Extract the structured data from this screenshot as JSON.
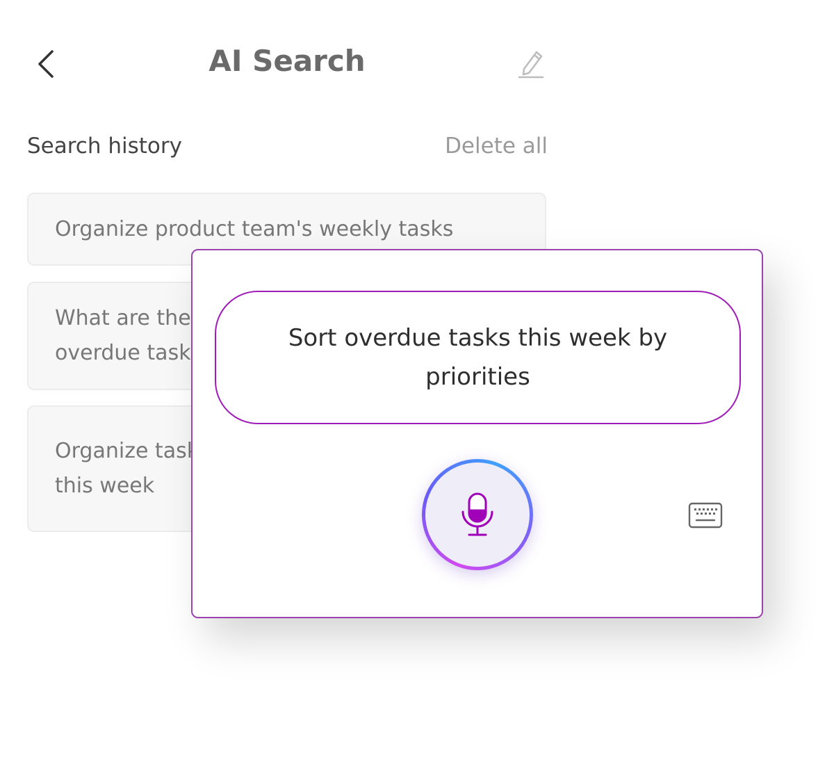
{
  "header": {
    "title": "AI Search"
  },
  "history": {
    "heading": "Search history",
    "delete_all_label": "Delete all",
    "items": [
      {
        "text": "Organize product team's weekly tasks"
      },
      {
        "text": "What are the overdue tasks"
      },
      {
        "text": "Organize tasks by this week"
      }
    ]
  },
  "voice": {
    "query_text": "Sort overdue tasks this week by priorities"
  },
  "icons": {
    "back": "chevron-left-icon",
    "edit": "pencil-icon",
    "mic": "microphone-icon",
    "keyboard": "keyboard-icon"
  },
  "colors": {
    "accent": "#a11bb8",
    "mic_fill": "#a000b8"
  }
}
